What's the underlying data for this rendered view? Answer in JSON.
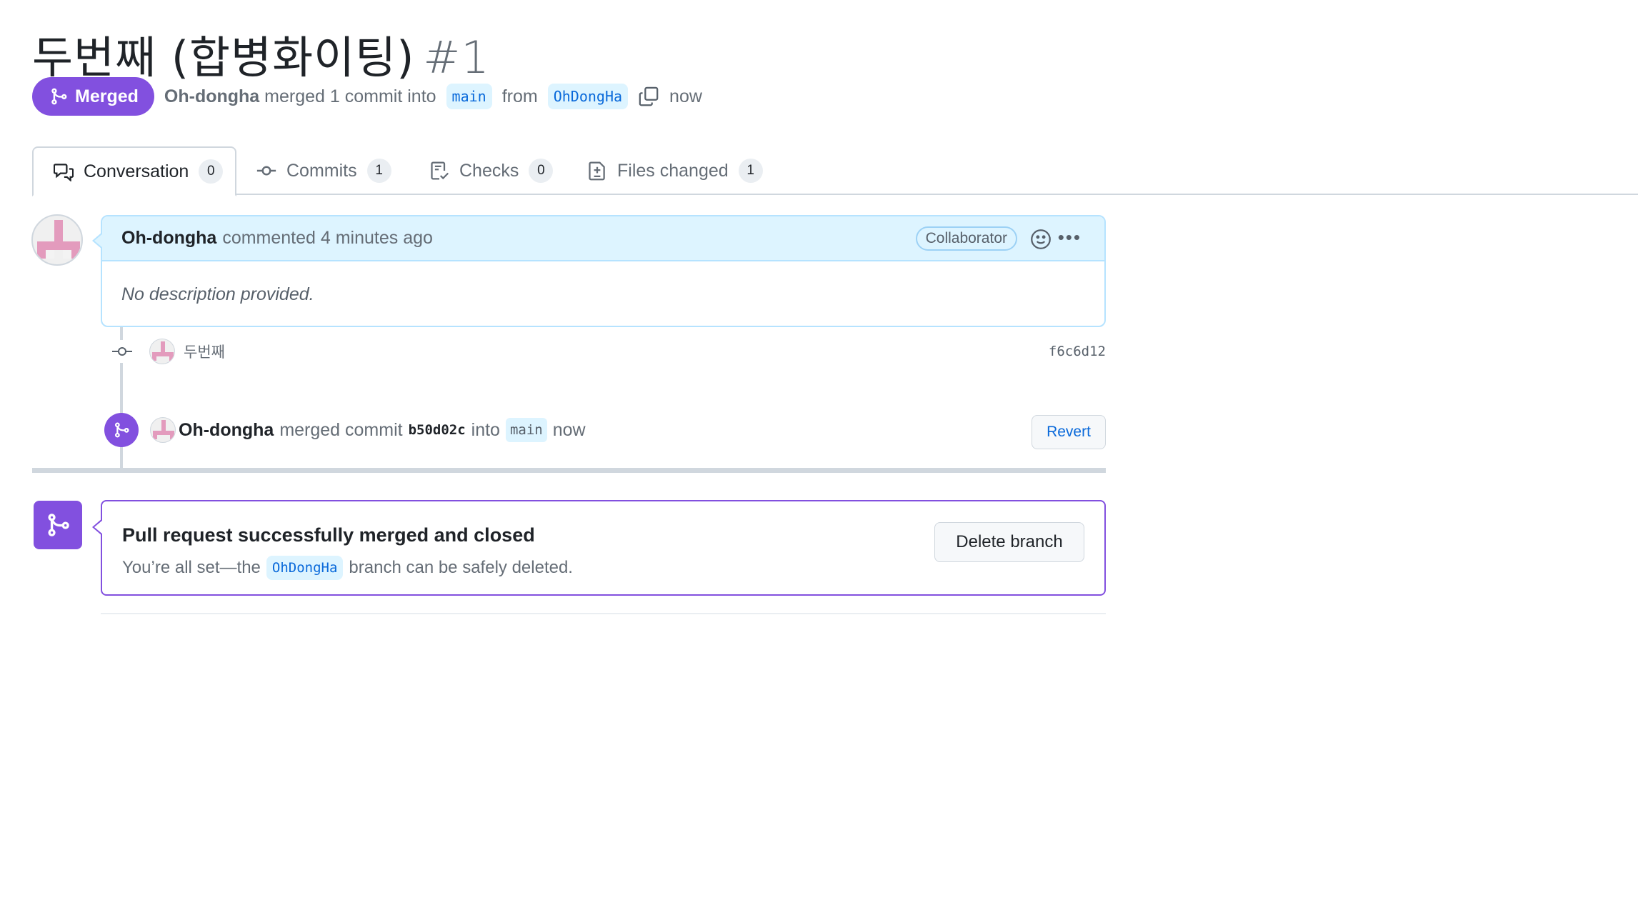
{
  "pr": {
    "title": "두번째 (합병화이팅)",
    "number": "#1",
    "state": "Merged",
    "author": "Oh-dongha",
    "action_text": "merged 1 commit into",
    "base_branch": "main",
    "from_text": "from",
    "head_branch": "OhDongHa",
    "time": "now"
  },
  "tabs": [
    {
      "label": "Conversation",
      "count": "0"
    },
    {
      "label": "Commits",
      "count": "1"
    },
    {
      "label": "Checks",
      "count": "0"
    },
    {
      "label": "Files changed",
      "count": "1"
    }
  ],
  "comment": {
    "author": "Oh-dongha",
    "meta": "commented 4 minutes ago",
    "role": "Collaborator",
    "body": "No description provided."
  },
  "commit": {
    "message": "두번째",
    "sha": "f6c6d12"
  },
  "merge_event": {
    "author": "Oh-dongha",
    "text1": "merged commit",
    "sha": "b50d02c",
    "text2": "into",
    "branch": "main",
    "time": "now",
    "revert_label": "Revert"
  },
  "merged_box": {
    "title": "Pull request successfully merged and closed",
    "sub_before": "You’re all set—the",
    "branch": "OhDongHa",
    "sub_after": "branch can be safely deleted.",
    "delete_label": "Delete branch"
  },
  "colors": {
    "merged_purple": "#8250df",
    "link_blue": "#0969da",
    "comment_header_bg": "#ddf4ff"
  }
}
